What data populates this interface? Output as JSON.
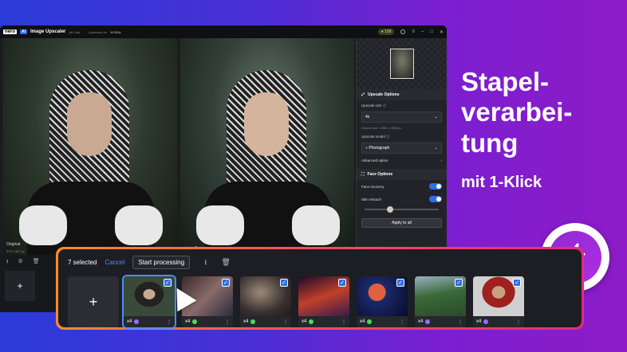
{
  "titlebar": {
    "brand": "nero",
    "ai_badge": "AI",
    "app_name": "Image Upscaler",
    "version": "(AI Lite)",
    "optimized": "Optimized for",
    "partner": "NVIDIA",
    "coins": "198"
  },
  "preview": {
    "left_label": "Original",
    "left_size": "272 x 347 px"
  },
  "sidebar": {
    "upscale_header": "Upscale Options",
    "upscale_size_label": "Upscale size",
    "upscale_size_value": "4x",
    "output_size": "Output size: 1088 x 1388 px",
    "model_label": "Upscale model",
    "model_value": "Photograph",
    "advanced": "Advanced option",
    "face_header": "Face Options",
    "face_recovery": "Face recovery",
    "skin_retouch": "Skin retouch",
    "skin_level": 0.3,
    "apply_all": "Apply to all"
  },
  "promo": {
    "headline": "Stapel-\nverarbei-\ntung",
    "sub": "mit 1-Klick"
  },
  "batch": {
    "selected": "7 selected",
    "cancel": "Cancel",
    "start": "Start processing",
    "tiles": [
      {
        "scale": "x4",
        "dot": "#9b6bff",
        "img": "radial-gradient(ellipse at 50% 45%,#c9a991 0 16%,#222 17% 40%,#3a4a3a 41%)"
      },
      {
        "scale": "x4",
        "dot": "#4cd964",
        "img": "linear-gradient(135deg,#3a2a2a,#8a6a6a 50%,#2a2a3a)"
      },
      {
        "scale": "x4",
        "dot": "#4cd964",
        "img": "radial-gradient(ellipse at 40% 40%,#9a8a7a,#3a3030 60%,#1a1a1a)"
      },
      {
        "scale": "x4",
        "dot": "#4cd964",
        "img": "linear-gradient(160deg,#1a0a2a,#c0402a 50%,#3a1a4a)"
      },
      {
        "scale": "x4",
        "dot": "#4cd964",
        "img": "radial-gradient(circle at 40% 40%,#e06040 0 22%,#1a2a6a 23%,#0a0a2a)"
      },
      {
        "scale": "x4",
        "dot": "#9b6bff",
        "img": "linear-gradient(170deg,#9ab0c0,#3a6a3a 45%,#2a4a2a)"
      },
      {
        "scale": "x4",
        "dot": "#9b6bff",
        "img": "radial-gradient(ellipse at 50% 40%,#c9a080 0 18%,#a02020 19% 45%,#d0d0d0 46%)"
      }
    ]
  }
}
